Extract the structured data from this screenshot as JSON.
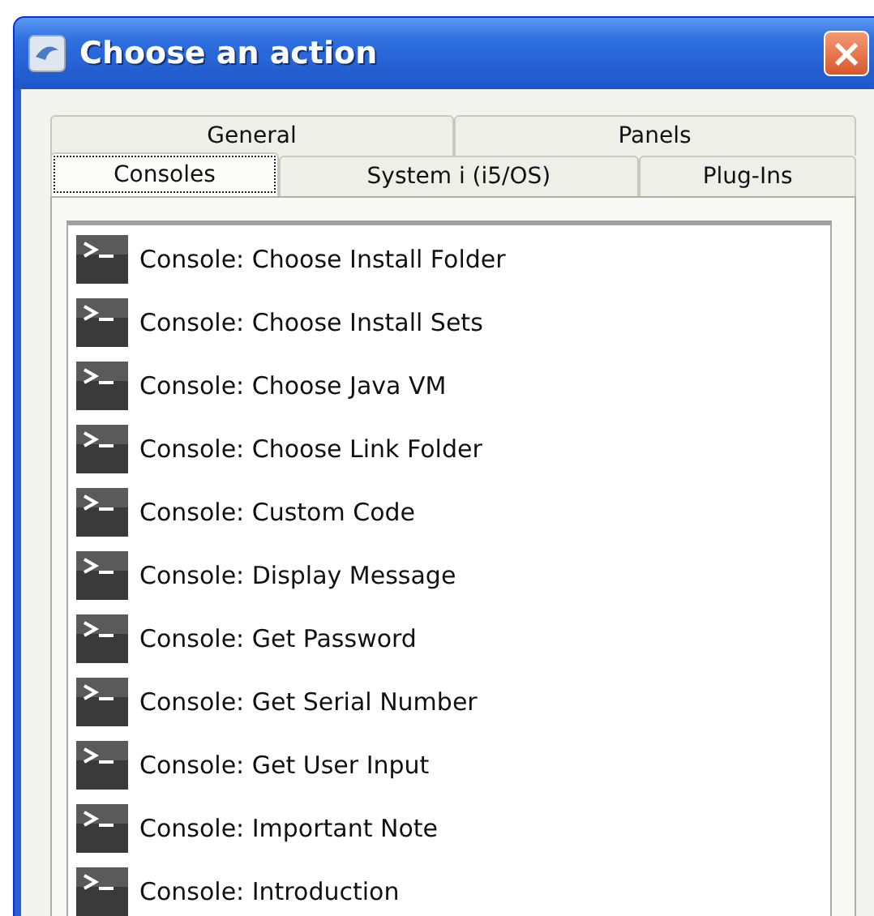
{
  "window": {
    "title": "Choose an action",
    "close_label": "×"
  },
  "tab_rows": [
    {
      "tabs": [
        {
          "label": "General",
          "selected": false
        },
        {
          "label": "Panels",
          "selected": false
        }
      ]
    },
    {
      "tabs": [
        {
          "label": "Consoles",
          "selected": true
        },
        {
          "label": "System i (i5/OS)",
          "selected": false
        },
        {
          "label": "Plug-Ins",
          "selected": false
        }
      ]
    }
  ],
  "actions": [
    {
      "label": "Console: Choose Install Folder"
    },
    {
      "label": "Console: Choose Install Sets"
    },
    {
      "label": "Console: Choose Java VM"
    },
    {
      "label": "Console: Choose Link Folder"
    },
    {
      "label": "Console: Custom Code"
    },
    {
      "label": "Console: Display Message"
    },
    {
      "label": "Console: Get Password"
    },
    {
      "label": "Console: Get Serial Number"
    },
    {
      "label": "Console: Get User Input"
    },
    {
      "label": "Console: Important Note"
    },
    {
      "label": "Console: Introduction"
    }
  ]
}
